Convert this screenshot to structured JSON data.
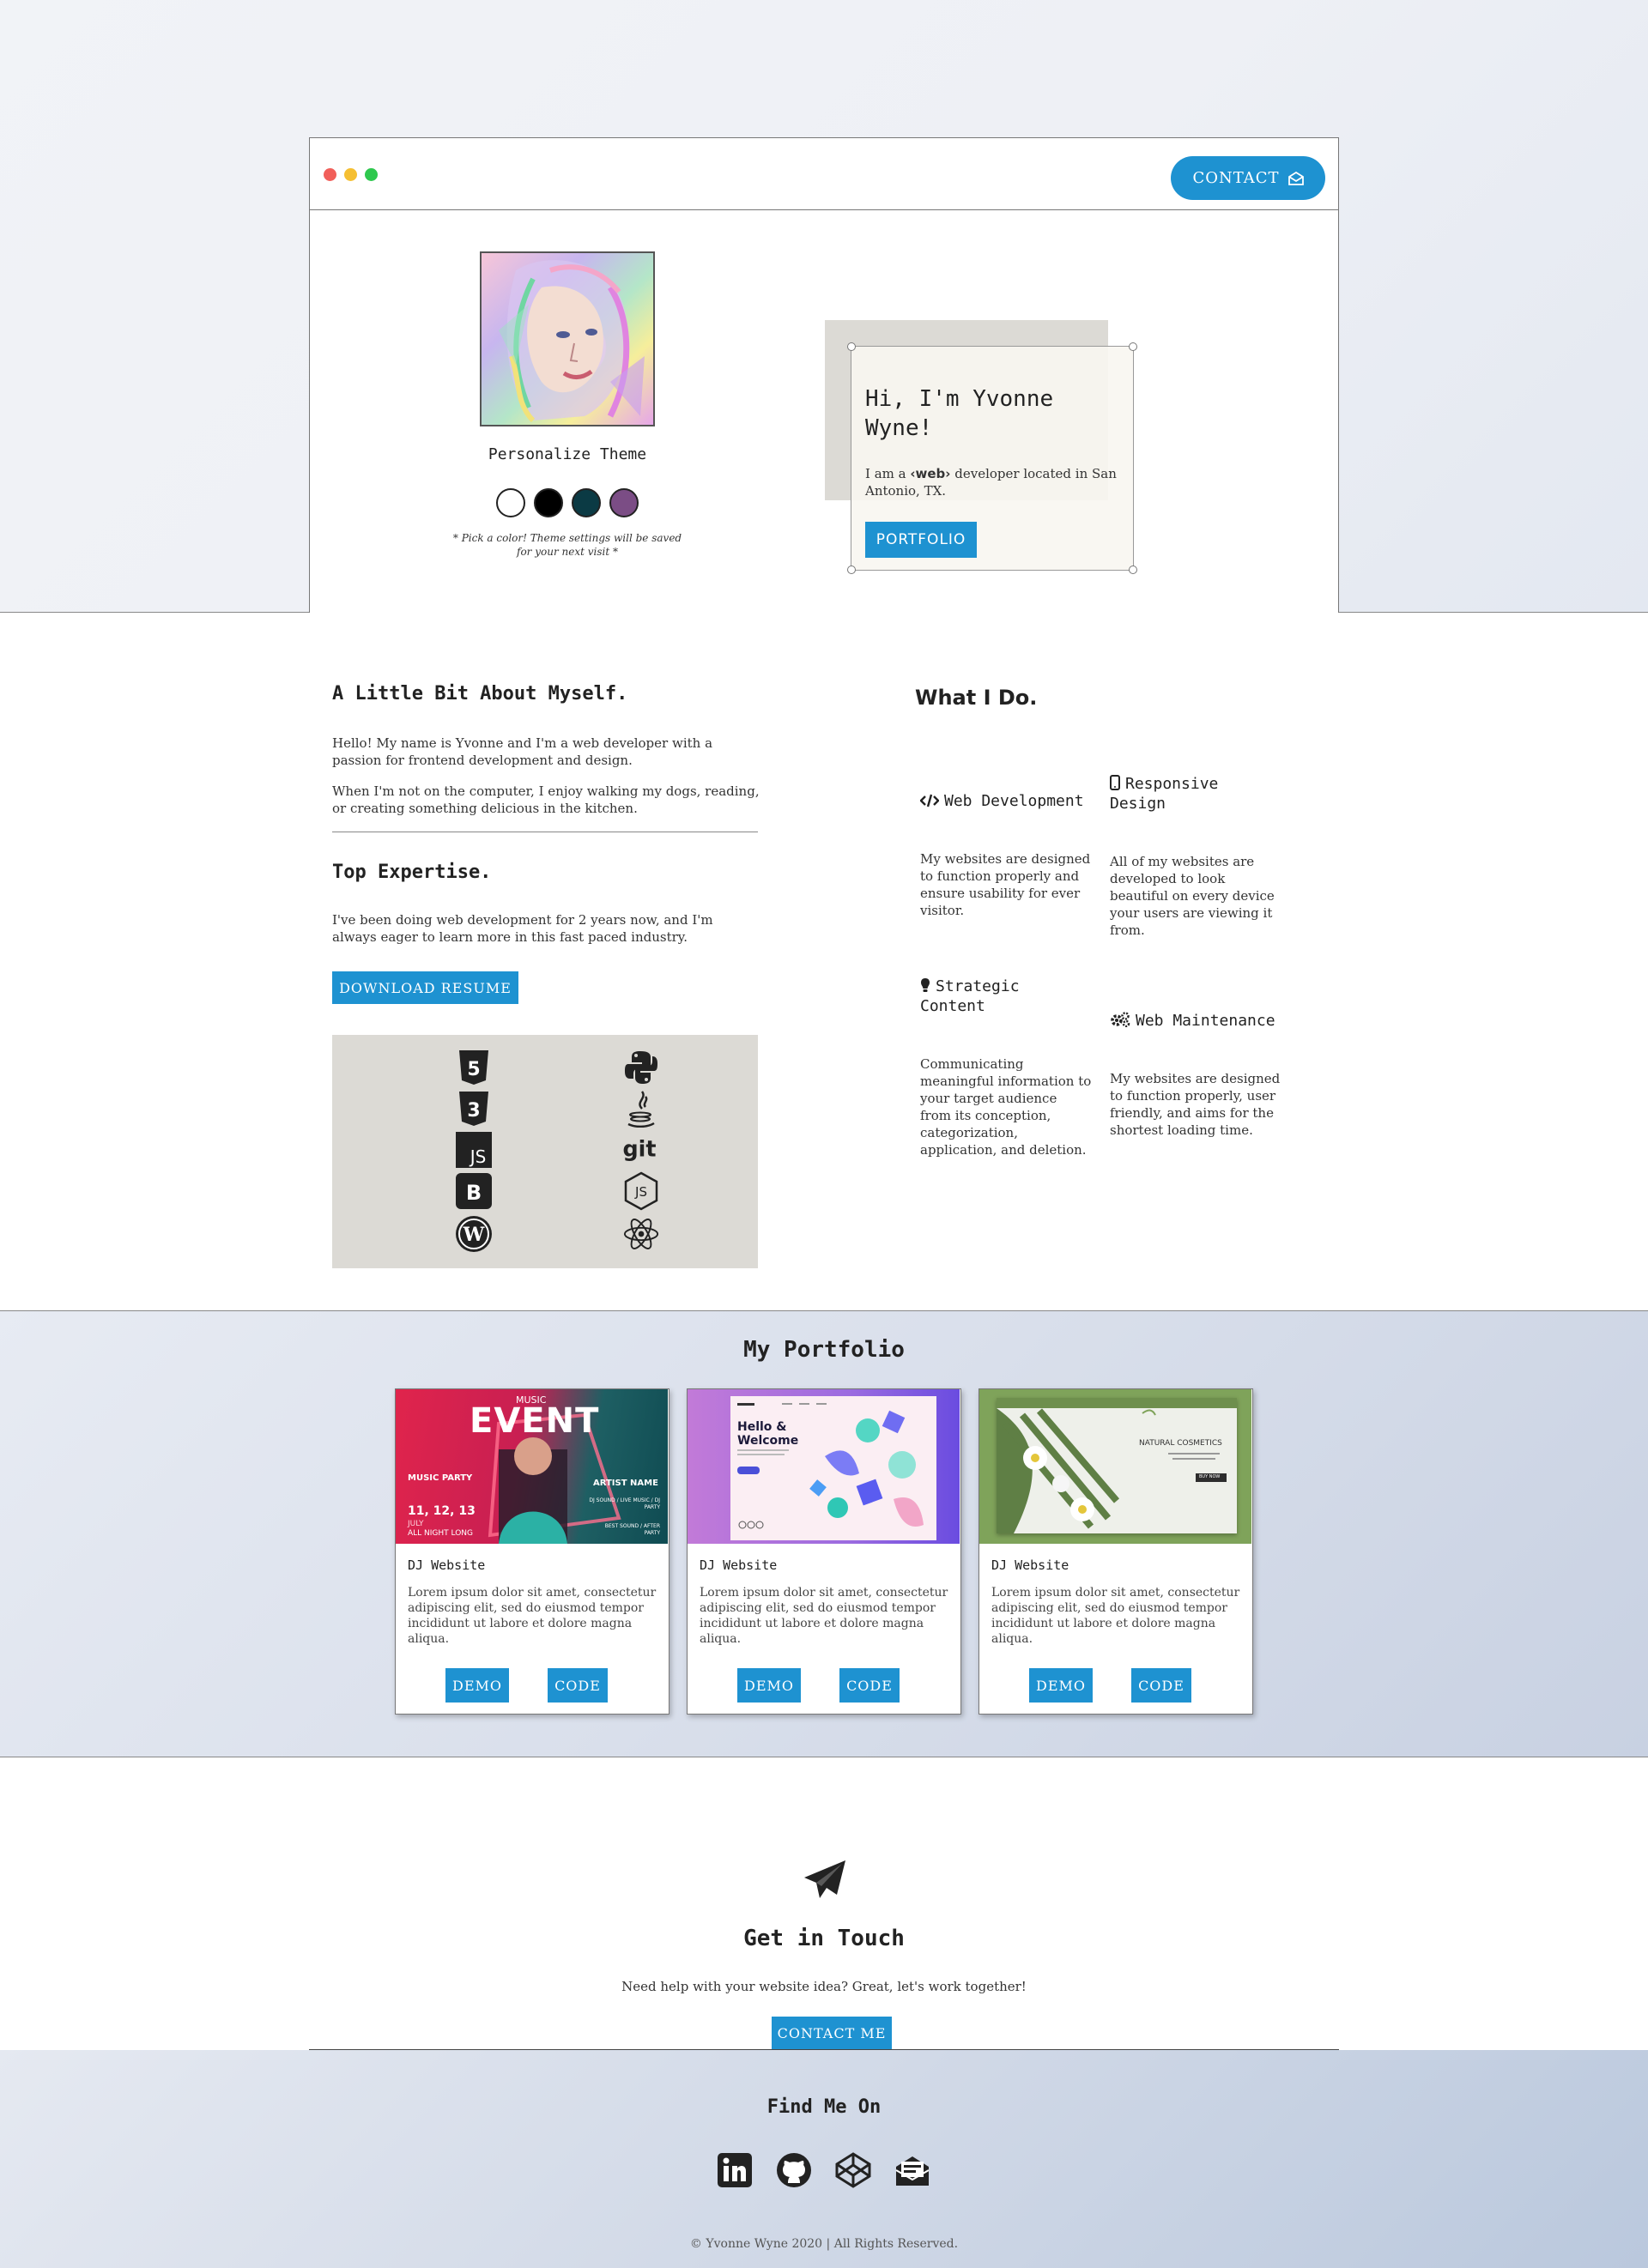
{
  "header": {
    "contact_label": "CONTACT",
    "contact_icon": "envelope-open-icon"
  },
  "hero": {
    "theme_label": "Personalize Theme",
    "theme_note": "* Pick a color! Theme settings will be saved for your next visit *",
    "swatches": [
      "#ffffff",
      "#000000",
      "#0b3a44",
      "#7b4d85"
    ],
    "intro_title": "Hi, I'm Yvonne Wyne!",
    "intro_prefix": "I am a ",
    "intro_tag": "‹web›",
    "intro_suffix": " developer located in San Antonio, TX.",
    "portfolio_label": "PORTFOLIO"
  },
  "about": {
    "title": "A Little Bit About Myself.",
    "p1": "Hello! My name is Yvonne and I'm a web developer with a passion for frontend development and design.",
    "p2": "When I'm not on the computer, I enjoy walking my dogs, reading, or creating something delicious in the kitchen.",
    "expertise_title": "Top Expertise.",
    "expertise_text": "I've been doing web development for 2 years now, and I'm always eager to learn more in this fast paced industry.",
    "resume_label": "DOWNLOAD RESUME",
    "skill_icons": [
      "html5-icon",
      "css3-icon",
      "javascript-icon",
      "bootstrap-icon",
      "wordpress-icon",
      "python-icon",
      "java-icon",
      "git-icon",
      "nodejs-icon",
      "react-icon"
    ]
  },
  "services": {
    "title": "What I Do.",
    "items": [
      {
        "icon": "code-icon",
        "title": "Web Development",
        "text": "My websites are designed to function properly and ensure usability for ever visitor."
      },
      {
        "icon": "mobile-icon",
        "title": "Responsive Design",
        "text": "All of my websites are developed to look beautiful on every device your users are viewing it from."
      },
      {
        "icon": "lightbulb-icon",
        "title": "Strategic Content",
        "text": "Communicating meaningful information to your target audience from its conception, categorization, application, and deletion."
      },
      {
        "icon": "cogs-icon",
        "title": "Web Maintenance",
        "text": "My websites are designed to function properly, user friendly, and aims for the shortest loading time."
      }
    ]
  },
  "portfolio": {
    "title": "My Portfolio",
    "cards": [
      {
        "title": "DJ Website",
        "text": "Lorem ipsum dolor sit amet, consectetur adipiscing elit, sed do eiusmod tempor incididunt ut labore et dolore magna aliqua.",
        "demo": "DEMO",
        "code": "CODE",
        "thumb": {
          "eyebrow": "MUSIC",
          "heading": "EVENT",
          "party": "MUSIC PARTY",
          "dates": "11, 12, 13",
          "month": "JULY",
          "tagline": "ALL NIGHT LONG",
          "artist": "ARTIST NAME",
          "lineup": "DJ SOUND / LIVE MUSIC / DJ PARTY",
          "after": "BEST SOUND / AFTER PARTY"
        }
      },
      {
        "title": "DJ Website",
        "text": "Lorem ipsum dolor sit amet, consectetur adipiscing elit, sed do eiusmod tempor incididunt ut labore et dolore magna aliqua.",
        "demo": "DEMO",
        "code": "CODE",
        "thumb": {
          "heading": "Hello & Welcome"
        }
      },
      {
        "title": "DJ Website",
        "text": "Lorem ipsum dolor sit amet, consectetur adipiscing elit, sed do eiusmod tempor incididunt ut labore et dolore magna aliqua.",
        "demo": "DEMO",
        "code": "CODE",
        "thumb": {
          "heading": "NATURAL COSMETICS",
          "button": "BUY NOW"
        }
      }
    ]
  },
  "contact": {
    "title": "Get in Touch",
    "text": "Need help with your website idea? Great, let's work together!",
    "button": "CONTACT ME"
  },
  "footer": {
    "title": "Find Me On",
    "socials": [
      "linkedin-icon",
      "github-icon",
      "codepen-icon",
      "mail-bulk-icon"
    ],
    "copyright": "© Yvonne Wyne 2020 | All Rights Reserved."
  },
  "colors": {
    "accent": "#1e92d1",
    "dot_red": "#f15f5a",
    "dot_yellow": "#f5bf32",
    "dot_green": "#2ec84e"
  }
}
